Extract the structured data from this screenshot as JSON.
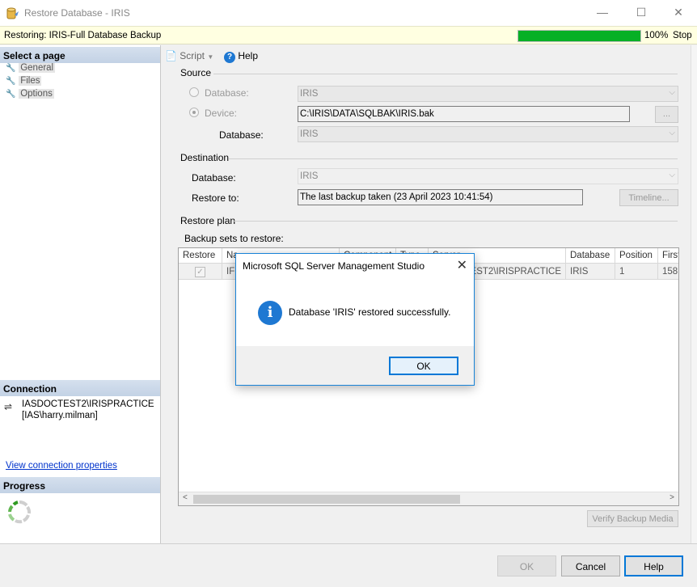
{
  "window": {
    "title": "Restore Database - IRIS",
    "minimize": "—",
    "maximize": "☐",
    "close": "✕"
  },
  "status": {
    "text": "Restoring: IRIS-Full Database Backup",
    "progress_percent": 100,
    "progress_label": "100%",
    "stop_label": "Stop",
    "progress_color": "#06b025"
  },
  "left": {
    "select_page_header": "Select a page",
    "pages": [
      {
        "label": "General"
      },
      {
        "label": "Files"
      },
      {
        "label": "Options"
      }
    ],
    "connection_header": "Connection",
    "server": "IASDOCTEST2\\IRISPRACTICE",
    "user": "[IAS\\harry.milman]",
    "view_connection_link": "View connection properties",
    "progress_header": "Progress"
  },
  "toolbar": {
    "script_label": "Script",
    "help_label": "Help"
  },
  "source": {
    "section_label": "Source",
    "database_radio_label": "Database:",
    "database_value": "IRIS",
    "device_radio_label": "Device:",
    "device_value": "C:\\IRIS\\DATA\\SQLBAK\\IRIS.bak",
    "browse_label": "...",
    "device_database_label": "Database:",
    "device_database_value": "IRIS"
  },
  "destination": {
    "section_label": "Destination",
    "database_label": "Database:",
    "database_value": "IRIS",
    "restore_to_label": "Restore to:",
    "restore_to_value": "The last backup taken (23 April 2023 10:41:54)",
    "timeline_label": "Timeline..."
  },
  "restore_plan": {
    "section_label": "Restore plan",
    "backup_sets_label": "Backup sets to restore:",
    "columns": [
      "Restore",
      "Na",
      "Component",
      "Type",
      "Server",
      "Database",
      "Position",
      "First"
    ],
    "row": {
      "restore": "✓",
      "name": "IF",
      "server_visible": "EST2\\IRISPRACTICE",
      "database": "IRIS",
      "position": "1",
      "first": "158"
    },
    "verify_label": "Verify Backup Media"
  },
  "buttons": {
    "ok": "OK",
    "cancel": "Cancel",
    "help": "Help"
  },
  "dialog": {
    "title": "Microsoft SQL Server Management Studio",
    "close": "✕",
    "icon": "i",
    "message": "Database 'IRIS' restored successfully.",
    "ok": "OK",
    "icon_color": "#1e78d2"
  }
}
